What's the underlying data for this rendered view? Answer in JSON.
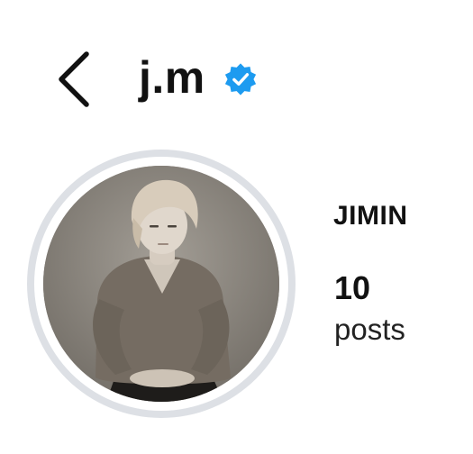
{
  "header": {
    "username": "j.m",
    "verified": true,
    "back_icon": "chevron-left-icon",
    "badge_icon": "verified-badge-icon",
    "badge_color": "#1d9bf0"
  },
  "profile": {
    "display_name": "JIMIN",
    "posts": {
      "count": "10",
      "label": "posts"
    },
    "avatar_ring_color": "#dde0e5"
  }
}
